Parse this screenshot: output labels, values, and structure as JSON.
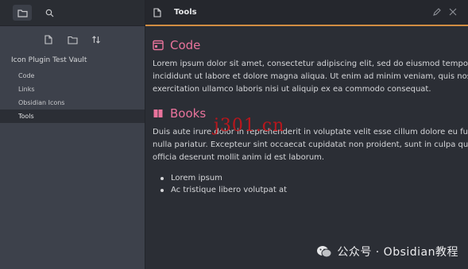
{
  "sidebar": {
    "vault_name": "Icon Plugin Test Vault",
    "items": [
      {
        "label": "Code",
        "active": false
      },
      {
        "label": "Links",
        "active": false
      },
      {
        "label": "Obsidian Icons",
        "active": false
      },
      {
        "label": "Tools",
        "active": true
      }
    ],
    "top_tabs": [
      "folder-icon",
      "search-icon"
    ],
    "actions": [
      "new-note-icon",
      "new-folder-icon",
      "sort-icon"
    ]
  },
  "tab": {
    "title": "Tools",
    "actions": [
      "edit-icon",
      "close-icon"
    ],
    "accent_color": "#d18d42"
  },
  "document": {
    "heading1": "Code",
    "paragraph1_lines": [
      "Lorem ipsum dolor sit amet, consectetur adipiscing elit, sed do eiusmod tempor",
      "incididunt ut labore et dolore magna aliqua. Ut enim ad minim veniam, quis nostrud",
      "exercitation ullamco laboris nisi ut aliquip ex ea commodo consequat."
    ],
    "heading2": "Books",
    "paragraph2_lines": [
      "Duis aute irure dolor in reprehenderit in voluptate velit esse cillum dolore eu fugiat",
      "nulla pariatur. Excepteur sint occaecat cupidatat non proident, sunt in culpa qui",
      "officia deserunt mollit anim id est laborum."
    ],
    "list": [
      "Lorem ipsum",
      "Ac tristique libero volutpat at"
    ],
    "heading_color": "#e9739c"
  },
  "overlays": {
    "watermark": "j301.cn",
    "wechat_label": "公众号 · Obsidian教程"
  }
}
